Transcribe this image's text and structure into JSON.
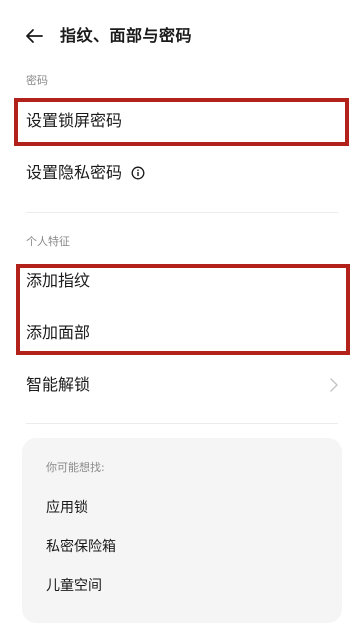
{
  "header": {
    "back_icon": "arrow-left-icon",
    "title": "指纹、面部与密码"
  },
  "sections": {
    "password_label": "密码",
    "personal_label": "个人特征"
  },
  "rows": {
    "lock_screen_password": "设置锁屏密码",
    "privacy_password": "设置隐私密码",
    "add_fingerprint": "添加指纹",
    "add_face": "添加面部",
    "smart_unlock": "智能解锁"
  },
  "icons": {
    "info": "info-circle-icon",
    "chevron": "chevron-right-icon"
  },
  "suggestions": {
    "title": "你可能想找:",
    "items": [
      "应用锁",
      "私密保险箱",
      "儿童空间"
    ]
  },
  "colors": {
    "highlight": "#b3211b",
    "card_background": "#f5f5f5",
    "secondary_text": "#8a8a8a"
  }
}
